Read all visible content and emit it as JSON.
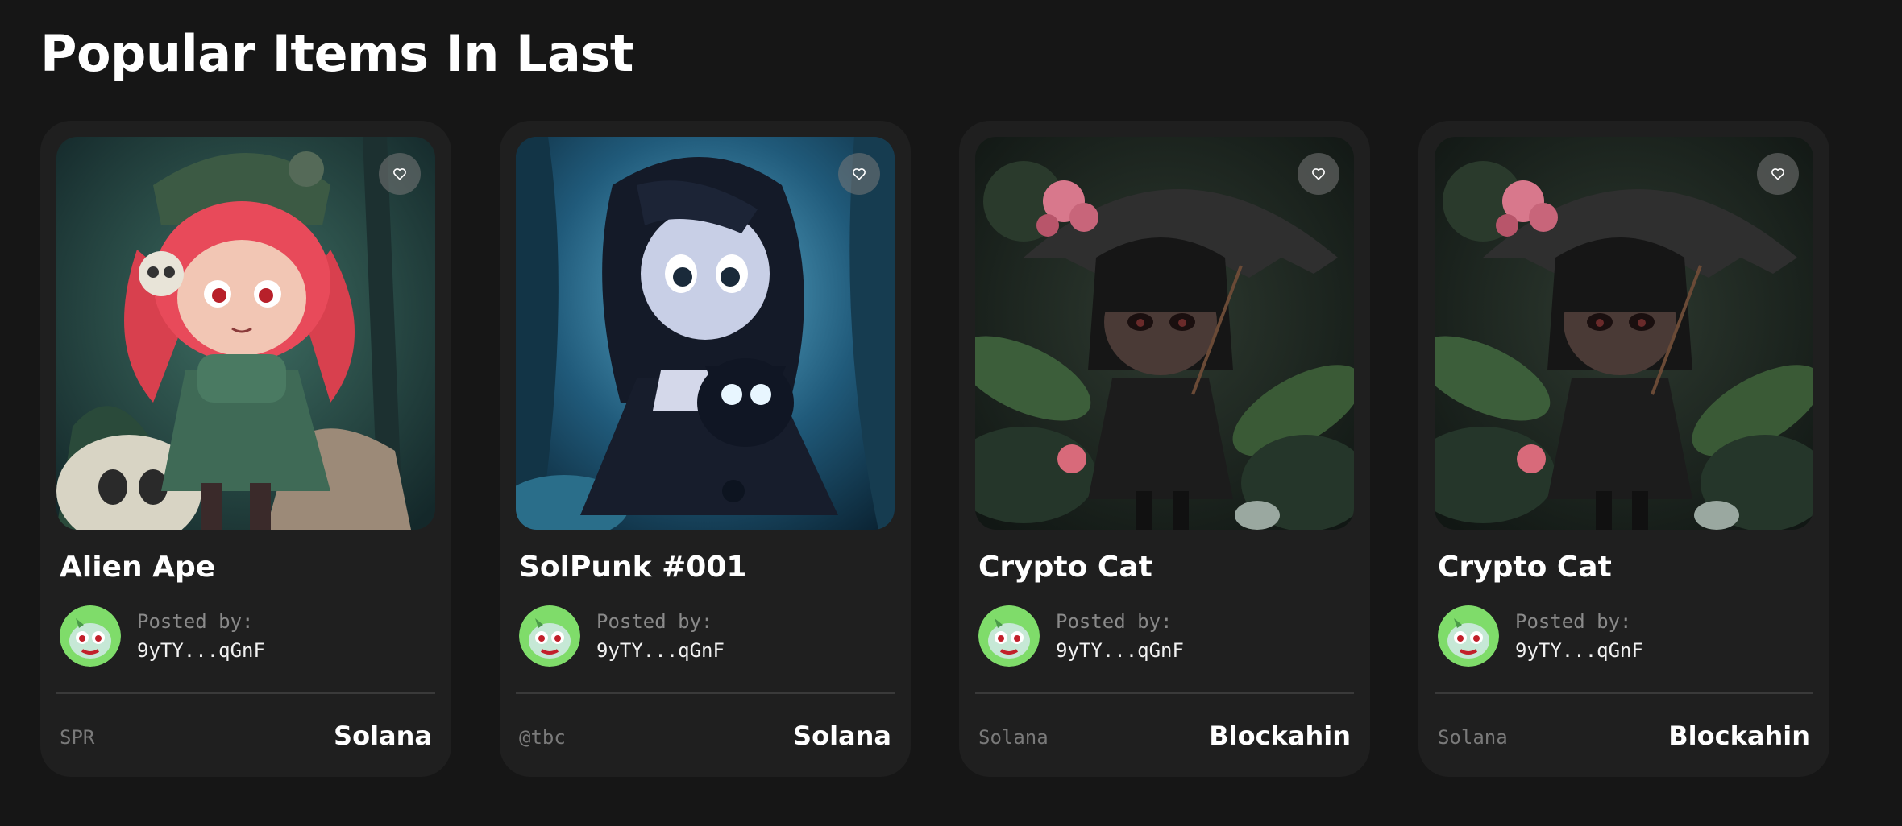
{
  "section": {
    "title": "Popular Items In Last"
  },
  "icons": {
    "like": "heart-icon"
  },
  "cards": [
    {
      "title": "Alien Ape",
      "posted_label": "Posted by:",
      "posted_by": "9yTY...qGnF",
      "tag": "SPR",
      "chain": "Solana",
      "art": "red-haired-witch-with-skull"
    },
    {
      "title": "SolPunk #001",
      "posted_label": "Posted by:",
      "posted_by": "9yTY...qGnF",
      "tag": "@tbc",
      "chain": "Solana",
      "art": "dark-haired-girl-with-black-cat"
    },
    {
      "title": "Crypto Cat",
      "posted_label": "Posted by:",
      "posted_by": "9yTY...qGnF",
      "tag": "Solana",
      "chain": "Blockahin",
      "art": "girl-with-umbrella-in-garden"
    },
    {
      "title": "Crypto Cat",
      "posted_label": "Posted by:",
      "posted_by": "9yTY...qGnF",
      "tag": "Solana",
      "chain": "Blockahin",
      "art": "girl-with-umbrella-in-garden"
    }
  ],
  "colors": {
    "background": "#161616",
    "card": "#1f1f1f",
    "muted_text": "#8a8a8a",
    "divider": "#3a3a3a"
  }
}
